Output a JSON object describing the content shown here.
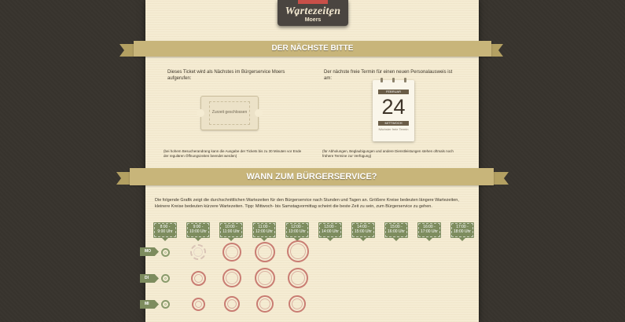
{
  "header": {
    "title": "Wartezeiten",
    "subtitle": "Moers",
    "star": "★"
  },
  "section1": {
    "banner": "DER NÄCHSTE BITTE",
    "left_text": "Dieses Ticket wird als Nächstes im Bürgerservice Moers aufgerufen:",
    "ticket_label": "Zurzeit geschlossen",
    "left_note": "(bei hohem Besucherandrang kann die Ausgabe der Tickets bis zu 30 Minuten vor Ende der regulären Öffnungszeiten beendet werden)",
    "right_text": "Der nächste freie Termin für einen neuen Personalausweis ist am:",
    "calendar": {
      "month": "FEBRUAR",
      "day": "24",
      "weekday": "MITTWOCH",
      "note": "Nächster freie Termin"
    },
    "right_note": "(für Abholungen, Beglaubigungen und andere Dienstleistungen stehen oftmals noch frühere Termine zur Verfügung)"
  },
  "section2": {
    "banner": "WANN ZUM BÜRGERSERVICE?",
    "description": "Die folgende Grafik zeigt die durchschnittlichen Wartezeiten für den Bürgerservice nach Stunden und Tagen an. Größere Kreise bedeuten längere Wartezeiten, kleinere Kreise bedeuten kürzere Wartezeiten. Tipp: Mittwoch- bis Samstagvormittag scheint die beste Zeit zu sein, zum Bürgerservice zu gehen.",
    "time_slots": [
      {
        "line1": "8:00 -",
        "line2": "9:00 Uhr"
      },
      {
        "line1": "9:00 -",
        "line2": "10:00 Uhr"
      },
      {
        "line1": "10:00 -",
        "line2": "11:00 Uhr"
      },
      {
        "line1": "11:00 -",
        "line2": "12:00 Uhr"
      },
      {
        "line1": "12:00 -",
        "line2": "13:00 Uhr"
      },
      {
        "line1": "13:00 -",
        "line2": "14:00 Uhr"
      },
      {
        "line1": "14:00 -",
        "line2": "15:00 Uhr"
      },
      {
        "line1": "15:00 -",
        "line2": "16:00 Uhr"
      },
      {
        "line1": "16:00 -",
        "line2": "17:00 Uhr"
      },
      {
        "line1": "17:00 -",
        "line2": "18:00 Uhr"
      }
    ],
    "days": [
      {
        "label": "MO"
      },
      {
        "label": "DI"
      },
      {
        "label": "MI"
      }
    ]
  },
  "colors": {
    "background": "#37332d",
    "paper": "#f5ecd3",
    "banner": "#c8b57a",
    "tag_green": "#7d8c5e",
    "circle_red": "#c97d73",
    "header": "#4a4540",
    "ribbon_red": "#c84f48"
  }
}
